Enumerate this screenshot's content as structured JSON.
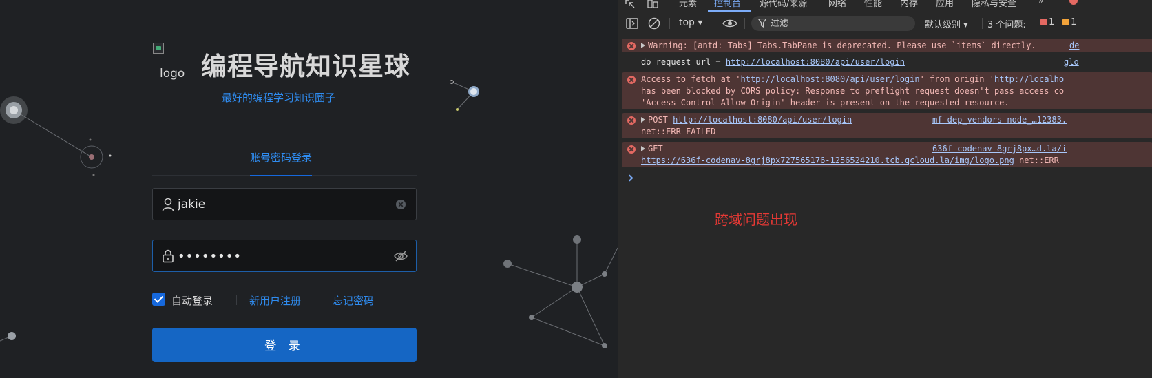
{
  "login": {
    "logo_alt": "logo",
    "title": "编程导航知识星球",
    "subtitle": "最好的编程学习知识圈子",
    "tab_label": "账号密码登录",
    "username_value": "jakie",
    "password_value": "••••••••",
    "remember_label": "自动登录",
    "register_link": "新用户注册",
    "forgot_link": "忘记密码",
    "submit_label": "登 录",
    "accent_color": "#1668dc"
  },
  "devtools": {
    "tabs": [
      "元素",
      "控制台",
      "源代码/来源",
      "网络",
      "性能",
      "内存",
      "应用",
      "隐私与安全"
    ],
    "more_tabs": "»",
    "active_tab": "控制台",
    "context": "top",
    "filter_placeholder": "过滤",
    "level": "默认级别",
    "issues_label": "3 个问题:",
    "error_count": "1",
    "warning_count": "1",
    "messages": [
      {
        "type": "error",
        "text": "Warning: [antd: Tabs] Tabs.TabPane is deprecated. Please use `items` directly.",
        "source": "de"
      },
      {
        "type": "log",
        "prefix": "do request url = ",
        "url": "http://localhost:8080/api/user/login",
        "source": "glo"
      },
      {
        "type": "error",
        "l1_pre": "Access to fetch at '",
        "l1_url": "http://localhost:8080/api/user/login",
        "l1_mid": "' from origin '",
        "l1_url2": "http://localho",
        "l2": "has been blocked by CORS policy: Response to preflight request doesn't pass access co",
        "l3": "'Access-Control-Allow-Origin' header is present on the requested resource."
      },
      {
        "type": "error",
        "method": "POST",
        "url": "http://localhost:8080/api/user/login",
        "source": "mf-dep_vendors-node_…12383.",
        "l2": "net::ERR_FAILED"
      },
      {
        "type": "error",
        "method": "GET",
        "source": "636f-codenav-8grj8px…d.la/i",
        "url": "https://636f-codenav-8grj8px727565176-1256524210.tcb.qcloud.la/img/logo.png",
        "tail": " net::ERR_"
      }
    ],
    "annotation": "跨域问题出现"
  }
}
